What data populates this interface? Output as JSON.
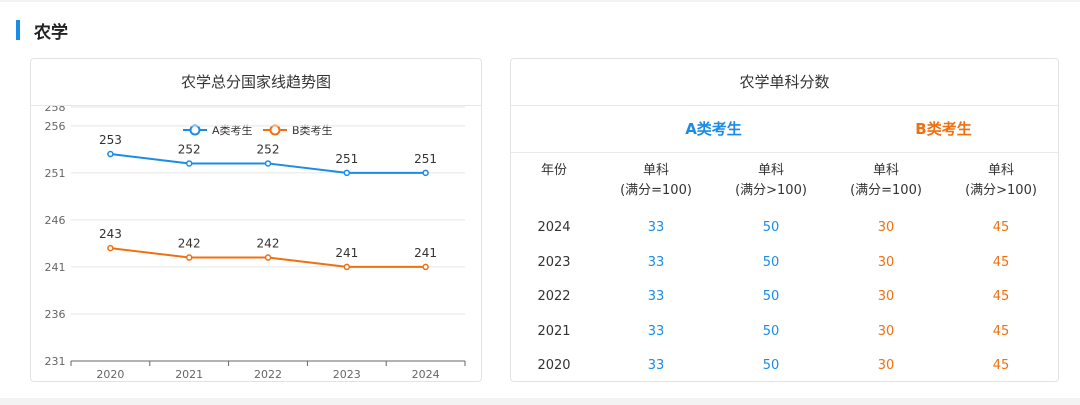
{
  "section": {
    "title": "农学"
  },
  "trend_card": {
    "title": "农学总分国家线趋势图"
  },
  "score_card": {
    "title": "农学单科分数",
    "group_a": "A类考生",
    "group_b": "B类考生",
    "columns": [
      {
        "line1": "年份",
        "line2": ""
      },
      {
        "line1": "单科",
        "line2": "(满分=100)"
      },
      {
        "line1": "单科",
        "line2": "(满分>100)"
      },
      {
        "line1": "单科",
        "line2": "(满分=100)"
      },
      {
        "line1": "单科",
        "line2": "(满分>100)"
      }
    ],
    "rows": [
      {
        "year": "2024",
        "a100": "33",
        "aover": "50",
        "b100": "30",
        "bover": "45"
      },
      {
        "year": "2023",
        "a100": "33",
        "aover": "50",
        "b100": "30",
        "bover": "45"
      },
      {
        "year": "2022",
        "a100": "33",
        "aover": "50",
        "b100": "30",
        "bover": "45"
      },
      {
        "year": "2021",
        "a100": "33",
        "aover": "50",
        "b100": "30",
        "bover": "45"
      },
      {
        "year": "2020",
        "a100": "33",
        "aover": "50",
        "b100": "30",
        "bover": "45"
      }
    ],
    "colors": {
      "a": "#1a8ce6",
      "b": "#f07010"
    }
  },
  "chart_data": {
    "type": "line",
    "title": "农学总分国家线趋势图",
    "x": [
      "2020",
      "2021",
      "2022",
      "2023",
      "2024"
    ],
    "series": [
      {
        "name": "A类考生",
        "values": [
          253,
          252,
          252,
          251,
          251
        ],
        "color": "#1a8ce6"
      },
      {
        "name": "B类考生",
        "values": [
          243,
          242,
          242,
          241,
          241
        ],
        "color": "#f07010"
      }
    ],
    "y_ticks": [
      231,
      236,
      241,
      246,
      251,
      256,
      258
    ],
    "ylim": [
      231,
      258
    ],
    "grid": true,
    "legend": "top-center"
  }
}
